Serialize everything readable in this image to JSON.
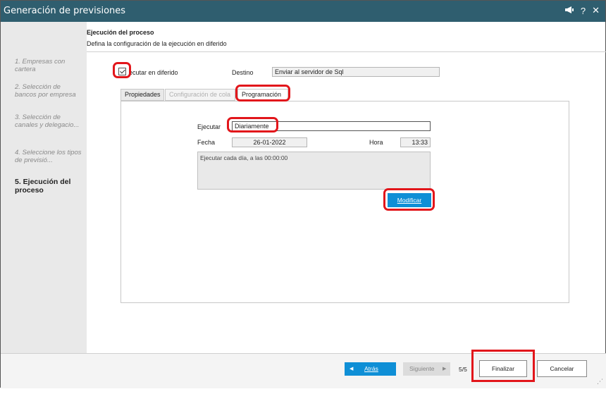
{
  "window": {
    "title": "Generación de previsiones",
    "icons": {
      "notify": "megaphone-icon",
      "help": "?",
      "close": "✕"
    }
  },
  "sidebar": {
    "items": [
      {
        "label": "1. Empresas con cartera"
      },
      {
        "label": "2. Selección de bancos por empresa"
      },
      {
        "label": "3. Selección de canales y delegacio..."
      },
      {
        "label": "4. Seleccione los tipos de previsió..."
      },
      {
        "label": "5. Ejecución del proceso"
      }
    ]
  },
  "header": {
    "title": "Ejecución del proceso",
    "description": "Defina la configuración de la ejecución en diferido"
  },
  "deferred": {
    "checkbox_label": "ecutar en diferido",
    "checked": true,
    "destino_label": "Destino",
    "destino_value": "Enviar al servidor de Sql"
  },
  "tabs": [
    {
      "label": "Propiedades"
    },
    {
      "label": "Configuración de cola"
    },
    {
      "label": "Programación"
    }
  ],
  "schedule": {
    "ejecutar_label": "Ejecutar",
    "ejecutar_value": "Diariamente",
    "fecha_label": "Fecha",
    "fecha_value": "26-01-2022",
    "hora_label": "Hora",
    "hora_value": "13:33",
    "summary": "Ejecutar cada día, a las 00:00:00",
    "modify_label": "Modificar"
  },
  "footer": {
    "back_label": "Atrás",
    "next_label": "Siguiente",
    "page_count": "5/5",
    "finish_label": "Finalizar",
    "cancel_label": "Cancelar"
  },
  "colors": {
    "titlebar": "#2f5e6f",
    "accent": "#0f8fd6",
    "highlight": "#e2161b"
  }
}
